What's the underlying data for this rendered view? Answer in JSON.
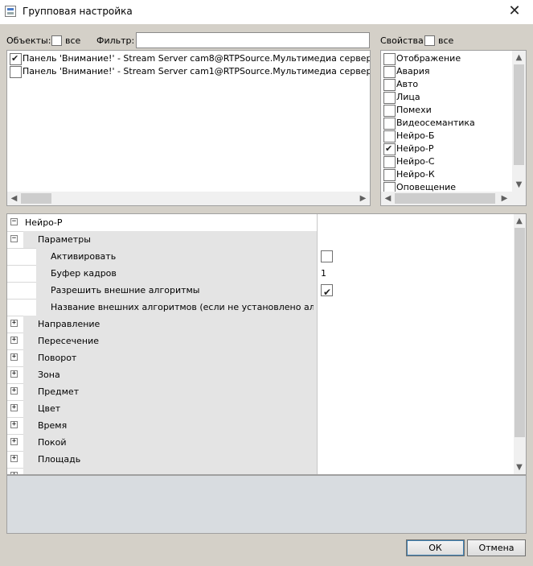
{
  "window": {
    "title": "Групповая настройка",
    "close_glyph": "✕"
  },
  "objects": {
    "label": "Объекты:",
    "all_label": "все",
    "all_checked": false,
    "items": [
      {
        "text": "Панель 'Внимание!' - Stream Server cam8@RTPSource.Мультимедиа сервер DESKTOP-D",
        "checked": true
      },
      {
        "text": "Панель 'Внимание!' - Stream Server cam1@RTPSource.Мультимедиа сервер DESKTOP-D",
        "checked": false
      }
    ]
  },
  "filter": {
    "label": "Фильтр:",
    "value": ""
  },
  "properties": {
    "label": "Свойства:",
    "all_label": "все",
    "all_checked": false,
    "items": [
      {
        "text": "Отображение",
        "checked": false
      },
      {
        "text": "Авария",
        "checked": false
      },
      {
        "text": "Авто",
        "checked": false
      },
      {
        "text": "Лица",
        "checked": false
      },
      {
        "text": "Помехи",
        "checked": false
      },
      {
        "text": "Видеосемантика",
        "checked": false
      },
      {
        "text": "Нейро-Б",
        "checked": false
      },
      {
        "text": "Нейро-Р",
        "checked": true
      },
      {
        "text": "Нейро-С",
        "checked": false
      },
      {
        "text": "Нейро-К",
        "checked": false
      },
      {
        "text": "Оповещение",
        "checked": false
      }
    ]
  },
  "grid": {
    "rows": [
      {
        "name": "Нейро-Р",
        "level": 0,
        "expander": "−",
        "value": ""
      },
      {
        "name": "Параметры",
        "level": 1,
        "expander": "−",
        "value": ""
      },
      {
        "name": "Активировать",
        "level": 2,
        "type": "checkbox",
        "checked": false
      },
      {
        "name": "Буфер кадров",
        "level": 2,
        "value": "1"
      },
      {
        "name": "Разрешить внешние алгоритмы",
        "level": 2,
        "type": "checkbox",
        "checked": true
      },
      {
        "name": "Название внешних алгоритмов (если не установлено алгорит...",
        "level": 2,
        "value": ""
      },
      {
        "name": "Направление",
        "level": 1,
        "expander": "+",
        "value": ""
      },
      {
        "name": "Пересечение",
        "level": 1,
        "expander": "+",
        "value": ""
      },
      {
        "name": "Поворот",
        "level": 1,
        "expander": "+",
        "value": ""
      },
      {
        "name": "Зона",
        "level": 1,
        "expander": "+",
        "value": ""
      },
      {
        "name": "Предмет",
        "level": 1,
        "expander": "+",
        "value": ""
      },
      {
        "name": "Цвет",
        "level": 1,
        "expander": "+",
        "value": ""
      },
      {
        "name": "Время",
        "level": 1,
        "expander": "+",
        "value": ""
      },
      {
        "name": "Покой",
        "level": 1,
        "expander": "+",
        "value": ""
      },
      {
        "name": "Площадь",
        "level": 1,
        "expander": "+",
        "value": ""
      },
      {
        "name": "",
        "level": 1,
        "expander": "+",
        "value": ""
      }
    ]
  },
  "buttons": {
    "ok": "ОК",
    "cancel": "Отмена"
  },
  "icons": {
    "app": "window-settings-icon",
    "close": "close-icon",
    "scroll_left": "◀",
    "scroll_right": "▶",
    "scroll_up": "▲",
    "scroll_down": "▼"
  }
}
